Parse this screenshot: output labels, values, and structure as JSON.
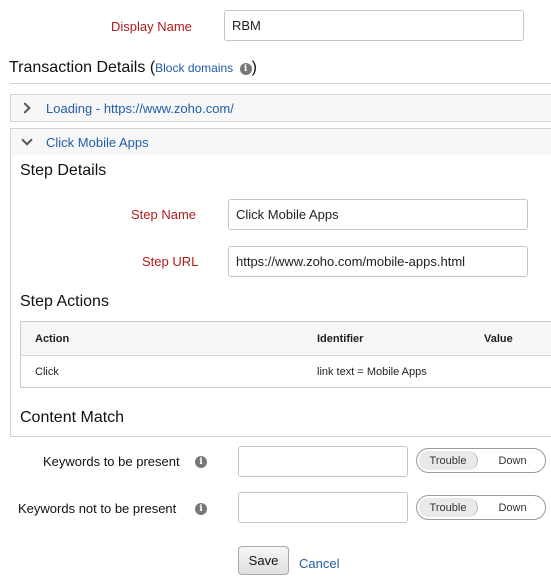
{
  "display_name": {
    "label": "Display Name",
    "value": "RBM"
  },
  "transaction_details": {
    "title": "Transaction Details",
    "open_paren": "(",
    "link": "Block domains",
    "close_paren": ")"
  },
  "steps": [
    {
      "label": "Loading - https://www.zoho.com/",
      "expanded": false
    },
    {
      "label": "Click Mobile Apps",
      "expanded": true
    }
  ],
  "step_details": {
    "title": "Step Details",
    "step_name_label": "Step Name",
    "step_name_value": "Click Mobile Apps",
    "step_url_label": "Step URL",
    "step_url_value": "https://www.zoho.com/mobile-apps.html"
  },
  "step_actions": {
    "title": "Step Actions",
    "columns": [
      "Action",
      "Identifier",
      "Value"
    ],
    "rows": [
      {
        "action": "Click",
        "identifier": "link text = Mobile Apps",
        "value": ""
      }
    ]
  },
  "content_match": {
    "title": "Content Match",
    "present_label": "Keywords to be present",
    "present_value": "",
    "not_present_label": "Keywords not to be present",
    "not_present_value": "",
    "toggle_options": [
      "Trouble",
      "Down"
    ],
    "selected": "Trouble"
  },
  "footer": {
    "save_label": "Save",
    "cancel_label": "Cancel"
  }
}
